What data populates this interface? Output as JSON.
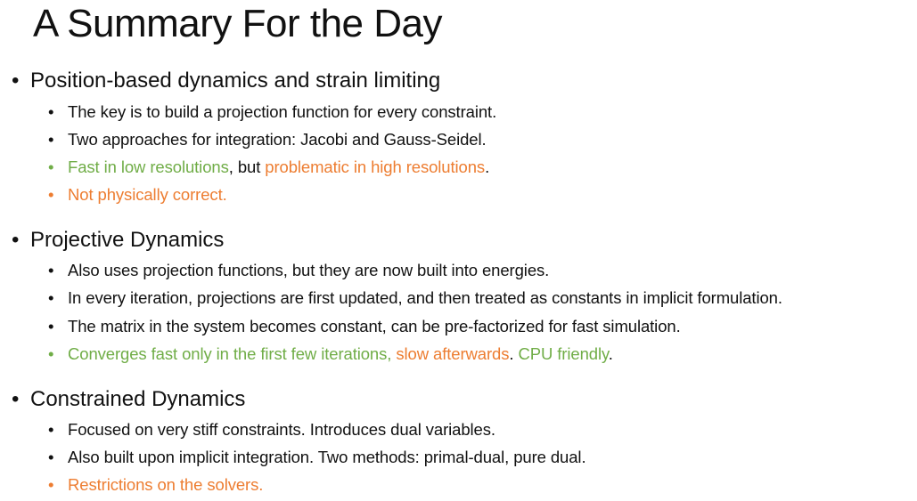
{
  "title": "A Summary For the Day",
  "colors": {
    "text": "#111111",
    "green": "#70ad47",
    "orange": "#ed7d31"
  },
  "bullet": "•",
  "sections": [
    {
      "heading": "Position-based dynamics and strain limiting",
      "items": [
        {
          "parts": [
            "The key is to build a projection function for every constraint."
          ],
          "bullet_color": "dark"
        },
        {
          "parts": [
            "Two approaches for integration: Jacobi and Gauss-Seidel."
          ],
          "bullet_color": "dark"
        },
        {
          "parts": [
            "Fast in low resolutions",
            ", but ",
            "problematic in high resolutions",
            "."
          ],
          "bullet_color": "green"
        },
        {
          "parts": [
            "Not physically correct."
          ],
          "bullet_color": "orange"
        }
      ]
    },
    {
      "heading": "Projective Dynamics",
      "items": [
        {
          "parts": [
            "Also uses projection functions, but they are now built into energies."
          ],
          "bullet_color": "dark"
        },
        {
          "parts": [
            "In every iteration, projections are first updated, and then treated as constants in implicit formulation."
          ],
          "bullet_color": "dark"
        },
        {
          "parts": [
            "The matrix in the system becomes constant, can be pre-factorized for fast simulation."
          ],
          "bullet_color": "dark"
        },
        {
          "parts": [
            "Converges fast only in the first few iterations, ",
            "slow afterwards",
            ".  ",
            "CPU friendly",
            "."
          ],
          "bullet_color": "green"
        }
      ]
    },
    {
      "heading": "Constrained Dynamics",
      "items": [
        {
          "parts": [
            "Focused on very stiff constraints.  Introduces dual variables."
          ],
          "bullet_color": "dark"
        },
        {
          "parts": [
            "Also built upon implicit integration.  Two methods: primal-dual, pure dual."
          ],
          "bullet_color": "dark"
        },
        {
          "parts": [
            "Restrictions on the solvers."
          ],
          "bullet_color": "orange"
        }
      ]
    }
  ]
}
